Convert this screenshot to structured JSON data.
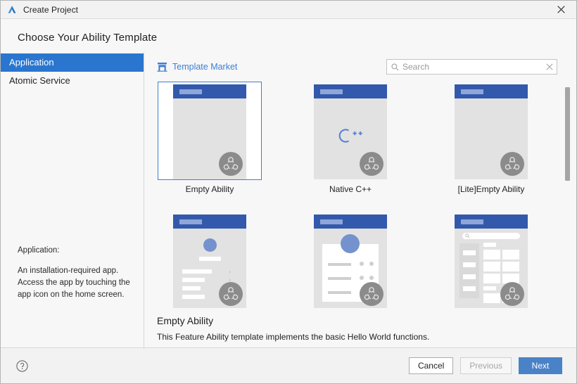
{
  "window": {
    "title": "Create Project",
    "logo_icon": "deveco-logo-icon",
    "close_icon": "close-icon"
  },
  "page": {
    "title": "Choose Your Ability Template"
  },
  "sidebar": {
    "items": [
      {
        "label": "Application",
        "selected": true
      },
      {
        "label": "Atomic Service",
        "selected": false
      }
    ],
    "description": {
      "title": "Application:",
      "body": "An installation-required app. Access the app by touching the app icon on the home screen."
    }
  },
  "toolbar": {
    "template_market_label": "Template Market",
    "template_market_icon": "shop-icon",
    "search": {
      "icon": "search-icon",
      "placeholder": "Search",
      "value": "",
      "clear_icon": "clear-x-icon"
    }
  },
  "templates": [
    {
      "label": "Empty Ability",
      "kind": "blank",
      "selected": true,
      "badge_icon": "harmonyos-badge-icon"
    },
    {
      "label": "Native C++",
      "kind": "cpp",
      "selected": false,
      "glyph": "C++",
      "badge_icon": "harmonyos-badge-icon"
    },
    {
      "label": "[Lite]Empty Ability",
      "kind": "blank",
      "selected": false,
      "badge_icon": "harmonyos-badge-icon"
    },
    {
      "label": "",
      "kind": "profile-list",
      "selected": false,
      "badge_icon": "harmonyos-badge-icon"
    },
    {
      "label": "",
      "kind": "card-detail",
      "selected": false,
      "badge_icon": "harmonyos-badge-icon"
    },
    {
      "label": "",
      "kind": "grid-nav",
      "selected": false,
      "badge_icon": "harmonyos-badge-icon"
    }
  ],
  "selection": {
    "title": "Empty Ability",
    "description": "This Feature Ability template implements the basic Hello World functions."
  },
  "footer": {
    "help_icon": "help-circle-icon",
    "cancel_label": "Cancel",
    "previous_label": "Previous",
    "previous_disabled": true,
    "next_label": "Next"
  },
  "colors": {
    "accent": "#2a76cf",
    "link": "#3d7fd4",
    "primary_button": "#4a82c7",
    "thumb_topbar": "#3259ab",
    "selection_border": "#3d7fd4"
  }
}
